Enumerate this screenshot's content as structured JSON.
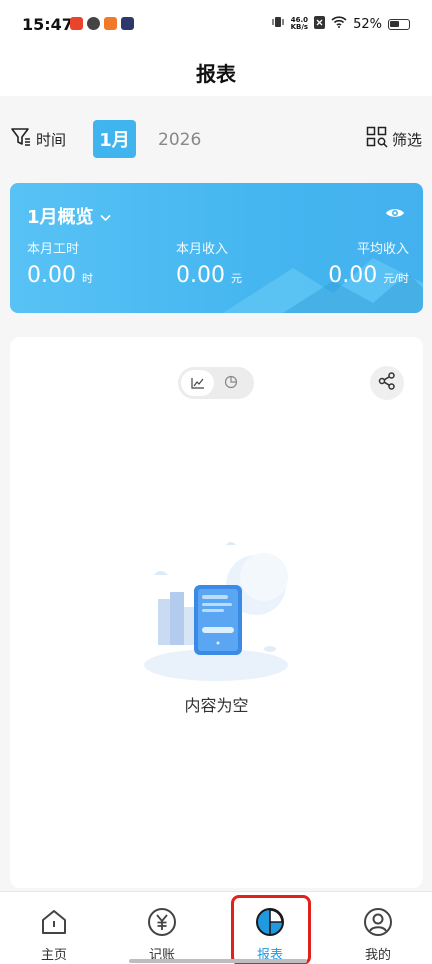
{
  "status_bar": {
    "time": "15:47",
    "net_speed_top": "46.0",
    "net_speed_bottom": "KB/s",
    "battery": "52%"
  },
  "header": {
    "title": "报表"
  },
  "filters": {
    "time_label": "时间",
    "month": "1月",
    "year": "2026",
    "filter_label": "筛选"
  },
  "overview": {
    "title": "1月概览",
    "stats": [
      {
        "label": "本月工时",
        "value": "0.00",
        "unit": "时"
      },
      {
        "label": "本月收入",
        "value": "0.00",
        "unit": "元"
      },
      {
        "label": "平均收入",
        "value": "0.00",
        "unit": "元/时"
      }
    ]
  },
  "chart_panel": {
    "empty_text": "内容为空",
    "selected_view": "line-chart"
  },
  "tabbar": {
    "items": [
      {
        "label": "主页",
        "icon": "home-icon"
      },
      {
        "label": "记账",
        "icon": "yuan-icon"
      },
      {
        "label": "报表",
        "icon": "pie-chart-icon",
        "active": true
      },
      {
        "label": "我的",
        "icon": "user-icon"
      }
    ]
  },
  "colors": {
    "accent": "#3fb4ee",
    "active_tab": "#1f9ae0",
    "highlight": "#e0221d"
  }
}
